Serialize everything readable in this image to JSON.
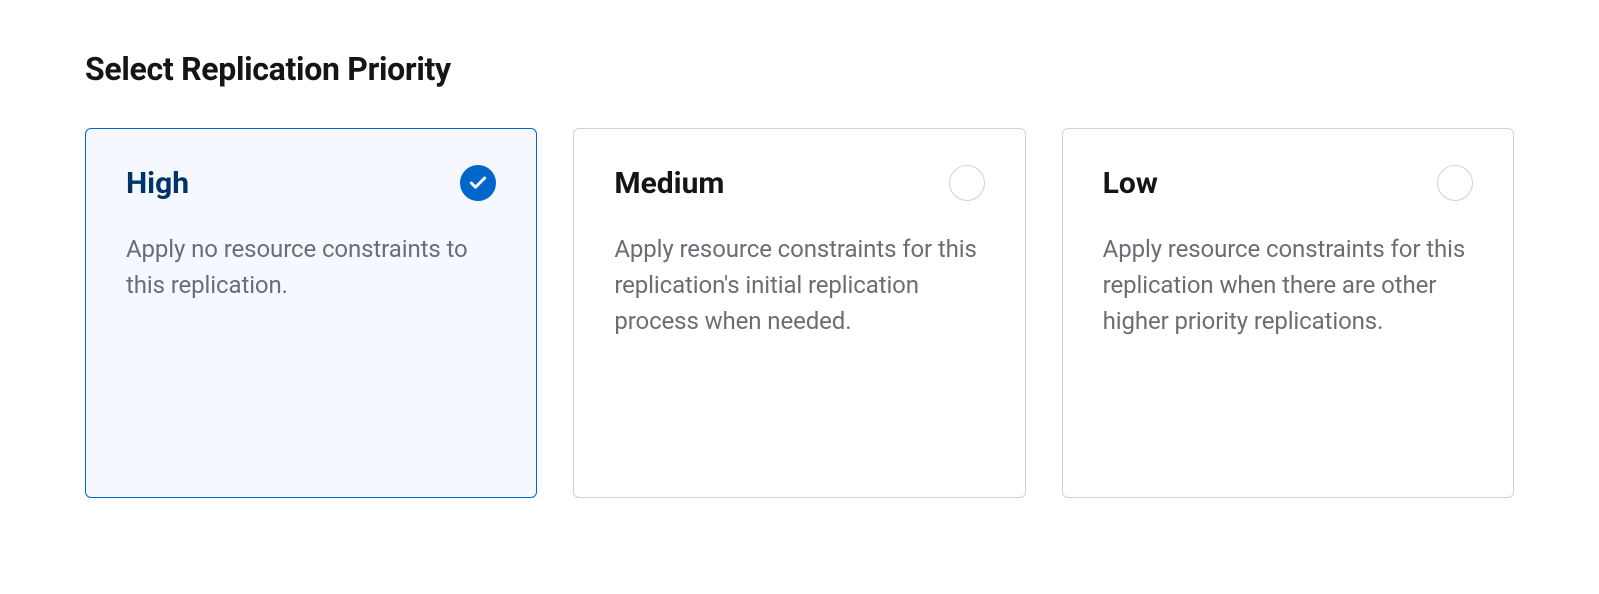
{
  "heading": "Select Replication Priority",
  "options": [
    {
      "title": "High",
      "description": "Apply no resource constraints to this replication.",
      "selected": true
    },
    {
      "title": "Medium",
      "description": "Apply resource constraints for this replication's initial replication process when needed.",
      "selected": false
    },
    {
      "title": "Low",
      "description": "Apply resource constraints for this replication when there are other higher priority replications.",
      "selected": false
    }
  ]
}
